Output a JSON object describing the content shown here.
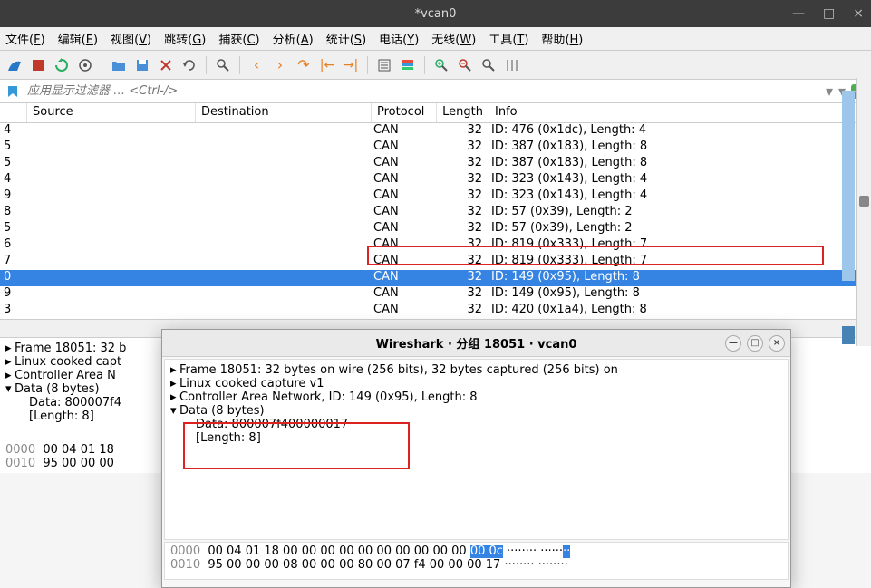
{
  "window": {
    "title": "*vcan0"
  },
  "menu": [
    {
      "label": "文件",
      "key": "F"
    },
    {
      "label": "编辑",
      "key": "E"
    },
    {
      "label": "视图",
      "key": "V"
    },
    {
      "label": "跳转",
      "key": "G"
    },
    {
      "label": "捕获",
      "key": "C"
    },
    {
      "label": "分析",
      "key": "A"
    },
    {
      "label": "统计",
      "key": "S"
    },
    {
      "label": "电话",
      "key": "Y"
    },
    {
      "label": "无线",
      "key": "W"
    },
    {
      "label": "工具",
      "key": "T"
    },
    {
      "label": "帮助",
      "key": "H"
    }
  ],
  "filter": {
    "placeholder": "应用显示过滤器 … <Ctrl-/>"
  },
  "columns": {
    "source": "Source",
    "destination": "Destination",
    "protocol": "Protocol",
    "length": "Length",
    "info": "Info"
  },
  "packets": [
    {
      "no": "4",
      "proto": "CAN",
      "len": "32",
      "info": "ID: 476 (0x1dc), Length: 4"
    },
    {
      "no": "5",
      "proto": "CAN",
      "len": "32",
      "info": "ID: 387 (0x183), Length: 8"
    },
    {
      "no": "5",
      "proto": "CAN",
      "len": "32",
      "info": "ID: 387 (0x183), Length: 8"
    },
    {
      "no": "4",
      "proto": "CAN",
      "len": "32",
      "info": "ID: 323 (0x143), Length: 4"
    },
    {
      "no": "9",
      "proto": "CAN",
      "len": "32",
      "info": "ID: 323 (0x143), Length: 4"
    },
    {
      "no": "8",
      "proto": "CAN",
      "len": "32",
      "info": "ID: 57 (0x39), Length: 2"
    },
    {
      "no": "5",
      "proto": "CAN",
      "len": "32",
      "info": "ID: 57 (0x39), Length: 2"
    },
    {
      "no": "6",
      "proto": "CAN",
      "len": "32",
      "info": "ID: 819 (0x333), Length: 7"
    },
    {
      "no": "7",
      "proto": "CAN",
      "len": "32",
      "info": "ID: 819 (0x333), Length: 7"
    },
    {
      "no": "0",
      "proto": "CAN",
      "len": "32",
      "info": "ID: 149 (0x95), Length: 8",
      "selected": true
    },
    {
      "no": "9",
      "proto": "CAN",
      "len": "32",
      "info": "ID: 149 (0x95), Length: 8"
    },
    {
      "no": "3",
      "proto": "CAN",
      "len": "32",
      "info": "ID: 420 (0x1a4), Length: 8"
    }
  ],
  "detail": {
    "l1": "Frame 18051: 32 b",
    "l2": "Linux cooked capt",
    "l3": "Controller Area N",
    "l4": "Data (8 bytes)",
    "l5": "Data: 800007f4",
    "l6": "[Length: 8]"
  },
  "hex_main": {
    "r1a": "0000",
    "r1b": "00 04 01 18",
    "r2a": "0010",
    "r2b": "95 00 00 00"
  },
  "dialog": {
    "title": "Wireshark · 分组 18051 · vcan0",
    "l1": "Frame 18051: 32 bytes on wire (256 bits), 32 bytes captured (256 bits) on",
    "l2": "Linux cooked capture v1",
    "l3": "Controller Area Network, ID: 149 (0x95), Length: 8",
    "l4": "Data (8 bytes)",
    "l5": "Data: 800007f400000017",
    "l6": "[Length: 8]",
    "hex": {
      "r1a": "0000",
      "r1b": "00 04 01 18 00 00 00 00  00 00 00 00 00 00 ",
      "r1sel": "00 0c",
      "r1c": "  ········ ······",
      "r1dot": "··",
      "r2a": "0010",
      "r2b": "95 00 00 00 08 00 00 00  80 00 07 f4 00 00 00 17",
      "r2c": "  ········ ········"
    }
  }
}
